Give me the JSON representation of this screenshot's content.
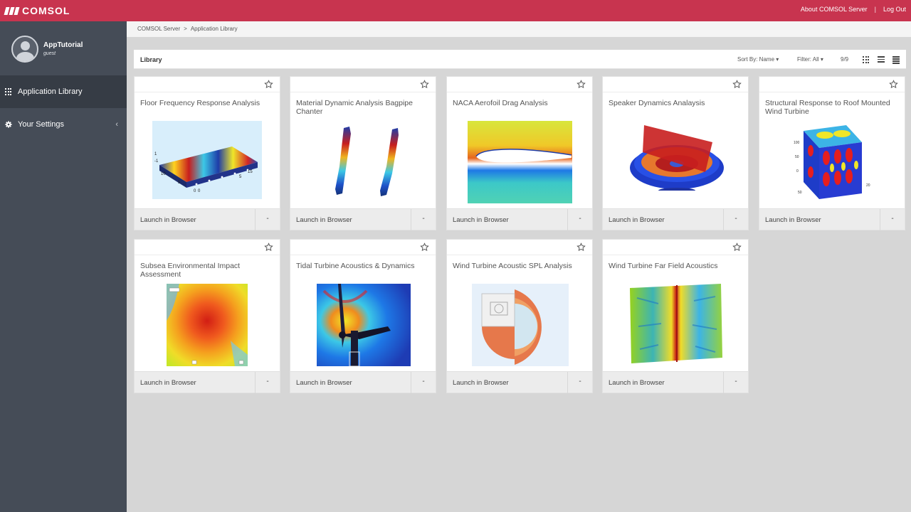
{
  "header": {
    "brand": "COMSOL",
    "about_label": "About COMSOL Server",
    "separator": "|",
    "logout_label": "Log Out",
    "color": "#c8344f"
  },
  "sidebar": {
    "user_name": "AppTutorial",
    "user_role": "guest",
    "items": [
      {
        "label": "Application Library",
        "icon": "grid-icon",
        "active": true
      },
      {
        "label": "Your Settings",
        "icon": "gear-icon",
        "chevron": "‹"
      }
    ]
  },
  "breadcrumb": [
    "COMSOL Server",
    ">",
    "Application Library"
  ],
  "library": {
    "title": "Library",
    "sort_label": "Sort By: Name ▾",
    "filter_label": "Filter: All ▾",
    "count": "9/9"
  },
  "cards": [
    {
      "title": "Floor Frequency Response Analysis",
      "launch": "Launch in Browser",
      "more": "-"
    },
    {
      "title": "Material Dynamic Analysis Bagpipe Chanter",
      "launch": "Launch in Browser",
      "more": "-"
    },
    {
      "title": "NACA Aerofoil Drag Analysis",
      "launch": "Launch in Browser",
      "more": "-"
    },
    {
      "title": "Speaker Dynamics Analaysis",
      "launch": "Launch in Browser",
      "more": "-"
    },
    {
      "title": "Structural Response to Roof Mounted Wind Turbine",
      "launch": "Launch in Browser",
      "more": "-"
    },
    {
      "title": "Subsea Environmental Impact Assessment",
      "launch": "Launch in Browser",
      "more": "-"
    },
    {
      "title": "Tidal Turbine Acoustics & Dynamics",
      "launch": "Launch in Browser",
      "more": "-"
    },
    {
      "title": "Wind Turbine Acoustic SPL Analysis",
      "launch": "Launch in Browser",
      "more": "-"
    },
    {
      "title": "Wind Turbine Far Field Acoustics",
      "launch": "Launch in Browser",
      "more": "-"
    }
  ]
}
